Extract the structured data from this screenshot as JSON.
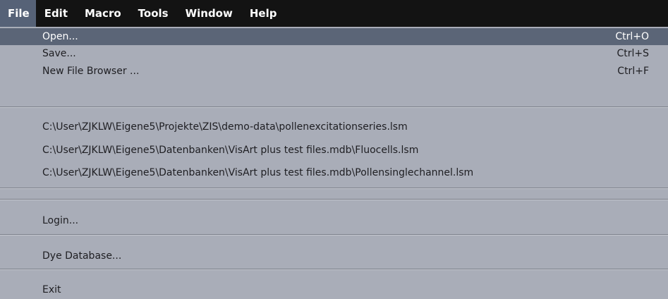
{
  "menubar": {
    "items": [
      "File",
      "Edit",
      "Macro",
      "Tools",
      "Window",
      "Help"
    ],
    "active": "File"
  },
  "file_menu": {
    "open": {
      "label": "Open...",
      "shortcut": "Ctrl+O"
    },
    "save": {
      "label": "Save...",
      "shortcut": "Ctrl+S"
    },
    "new_file_browser": {
      "label": "New File Browser ...",
      "shortcut": "Ctrl+F"
    },
    "recent_files": [
      "C:\\User\\ZJKLW\\Eigene5\\Projekte\\ZIS\\demo-data\\pollenexcitationseries.lsm",
      "C:\\User\\ZJKLW\\Eigene5\\Datenbanken\\VisArt plus test files.mdb\\Fluocells.lsm",
      "C:\\User\\ZJKLW\\Eigene5\\Datenbanken\\VisArt plus test files.mdb\\Pollensinglechannel.lsm"
    ],
    "login": "Login...",
    "dye_database": "Dye Database...",
    "exit": "Exit"
  },
  "colors": {
    "menubar_bg": "#131313",
    "menu_bg": "#a9adb8",
    "highlight_bg": "#5b6577",
    "active_tab_bg": "#566277"
  }
}
